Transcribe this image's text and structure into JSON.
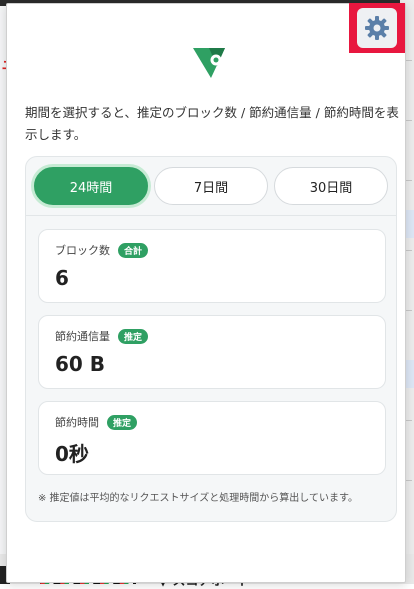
{
  "background": {
    "left_fragment": "モ",
    "bottom_heading": "▼ スコアボード"
  },
  "header": {
    "settings_icon": "gear-icon",
    "logo_icon": "shield-check-logo-icon"
  },
  "description": "期間を選択すると、推定のブロック数 / 節約通信量 / 節約時間を表示します。",
  "tabs": [
    {
      "label": "24時間",
      "active": true
    },
    {
      "label": "7日間",
      "active": false
    },
    {
      "label": "30日間",
      "active": false
    }
  ],
  "stats": [
    {
      "label": "ブロック数",
      "badge": "合計",
      "value": "6"
    },
    {
      "label": "節約通信量",
      "badge": "推定",
      "value": "60 B"
    },
    {
      "label": "節約時間",
      "badge": "推定",
      "value": "0秒"
    }
  ],
  "footnote": "※ 推定値は平均的なリクエストサイズと処理時間から算出しています。",
  "colors": {
    "accent": "#2fa063",
    "highlight_box": "#e8173f",
    "gear": "#5b7fa8"
  }
}
